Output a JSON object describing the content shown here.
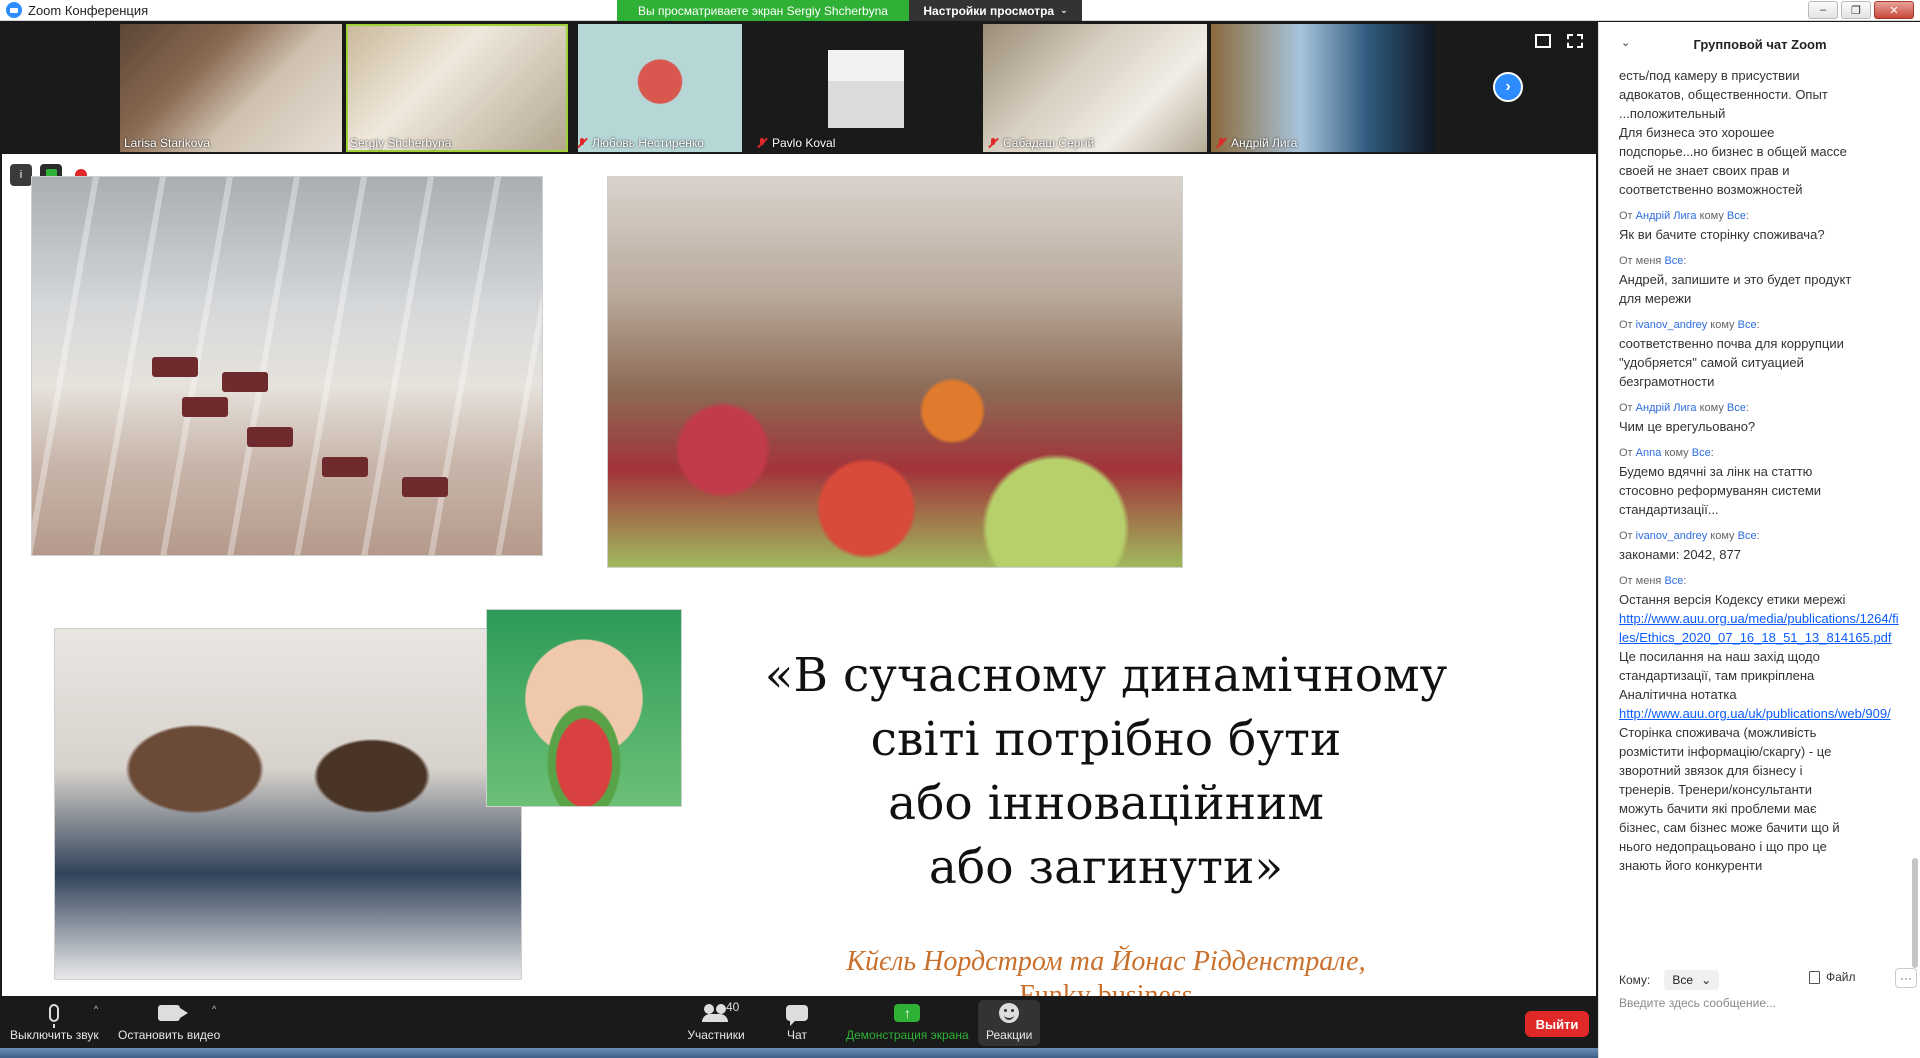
{
  "window": {
    "title": "Zoom Конференция",
    "share_banner": "Вы просматриваете экран Sergiy Shcherbyna",
    "view_settings": "Настройки просмотра",
    "controls": [
      "–",
      "❐",
      "✕"
    ]
  },
  "gallery": {
    "participants": [
      {
        "name": "Larisa Starikova",
        "muted": false,
        "active": false
      },
      {
        "name": "Sergiy Shcherbyna",
        "muted": false,
        "active": true
      },
      {
        "name": "Любовь Нестиренко",
        "muted": true,
        "active": false
      },
      {
        "name": "Pavlo Koval",
        "muted": true,
        "active": false
      },
      {
        "name": "Сабадаш Сергій",
        "muted": true,
        "active": false
      },
      {
        "name": "Андрій Лига",
        "muted": true,
        "active": false
      }
    ],
    "next_icon": "chevron-right-icon"
  },
  "slide": {
    "quote_lines": [
      "«В сучасному динамічному",
      "світі потрібно бути",
      "або інноваційним",
      "або загинути»"
    ],
    "author": "Кйєль Нордстром та Йонас Рідденстрале,",
    "book": "Funky business"
  },
  "toolbar": {
    "mute": "Выключить звук",
    "stop_video": "Остановить видео",
    "participants": "Участники",
    "participants_count": "40",
    "chat": "Чат",
    "share": "Демонстрация экрана",
    "reactions": "Реакции",
    "leave": "Выйти"
  },
  "chat": {
    "title": "Групповой чат Zoom",
    "messages": [
      {
        "meta": null,
        "lines": [
          "есть/под камеру в присуствии",
          "адвокатов, общественности. Опыт",
          "...положительный",
          "Для бизнеса это хорошее",
          "подспорье...но бизнес в общей массе",
          "своей не знает своих прав и",
          "соответственно возможностей"
        ]
      },
      {
        "from": "Андрій Лига",
        "to": "Все",
        "lines": [
          "Як ви бачите сторінку споживача?"
        ]
      },
      {
        "from": "меня",
        "to": "Все",
        "lines": [
          "Андрей, запишите и это будет продукт",
          "для мережи"
        ]
      },
      {
        "from": "ivanov_andrey",
        "to": "Все",
        "lines": [
          "соответственно почва для коррупции",
          "\"удобряется\" самой ситуацией",
          "безграмотности"
        ]
      },
      {
        "from": "Андрій Лига",
        "to": "Все",
        "lines": [
          "Чим це врегульовано?"
        ]
      },
      {
        "from": "Anna",
        "to": "Все",
        "lines": [
          "Будемо вдячні за лінк на статтю",
          "стосовно реформуванян системи",
          "стандартизації..."
        ]
      },
      {
        "from": "ivanov_andrey",
        "to": "Все",
        "lines": [
          "законами: 2042, 877"
        ]
      },
      {
        "from": "меня",
        "to": "Все",
        "lines": [
          "Остання версія Кодексу етики мережі"
        ],
        "link1": "http://www.auu.org.ua/media/publications/1264/files/Ethics_2020_07_16_18_51_13_814165.pdf",
        "lines2": [
          "Це посилання на наш захід щодо",
          "стандартизації, там прикріплена",
          "Аналітична нотатка"
        ],
        "link2": "http://www.auu.org.ua/uk/publications/web/909/",
        "lines3": [
          "Сторінка споживача (можливість",
          "розмістити інформацію/скаргу) - це",
          "зворотний звязок для бізнесу і",
          "тренерів. Тренери/консультанти",
          "можуть бачити які проблеми має",
          "бізнес, сам бізнес може бачити що й",
          "нього недопрацьовано і що про це",
          "знають його конкуренти"
        ]
      }
    ],
    "from_label": "От",
    "to_label": "кому",
    "to_prefix": "Кому:",
    "to_value": "Все",
    "file_label": "Файл",
    "more_label": "···",
    "input_placeholder": "Введите здесь сообщение..."
  }
}
